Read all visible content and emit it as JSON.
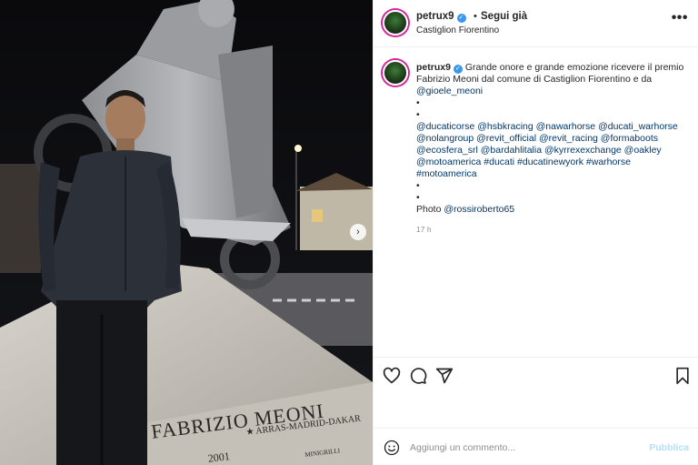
{
  "post": {
    "username": "petrux9",
    "follow_label": "Segui già",
    "separator": "•",
    "location": "Castiglion Fiorentino",
    "more_label": "•••",
    "next_label": "›"
  },
  "caption": {
    "username": "petrux9",
    "text": "Grande onore e grande emozione ricevere il premio Fabrizio Meoni dal comune di Castiglion Fiorentino e da",
    "mention_main": "@gioele_meoni",
    "bullet": "•",
    "tags_lines": [
      "@ducaticorse @hsbkracing @nawarhorse @ducati_warhorse",
      "@nolangroup @revit_official @revit_racing @formaboots",
      "@ecosfera_srl @bardahlitalia @kyrrexexchange @oakley",
      "@motoamerica #ducati #ducatinewyork #warhorse",
      "#motoamerica"
    ],
    "photo_prefix": "Photo ",
    "photo_credit": "@rossiroberto65",
    "time": "17 h"
  },
  "comment": {
    "placeholder": "Aggiungi un commento...",
    "publish_label": "Pubblica"
  },
  "photo_text": {
    "plaque_name": "FABRIZIO MEONI",
    "plaque_route": "★ ARRAS-MADRID-DAKAR",
    "plaque_year": "2001",
    "plaque_small": "MINIGRILLI"
  },
  "colors": {
    "link": "#00376b",
    "verified": "#3897f0",
    "publish_disabled": "#b2dffc",
    "muted": "#8e8e8e"
  },
  "icons": [
    "verified-badge-icon",
    "more-options-icon",
    "heart-icon",
    "comment-icon",
    "share-icon",
    "bookmark-icon",
    "emoji-icon",
    "next-arrow-icon"
  ]
}
